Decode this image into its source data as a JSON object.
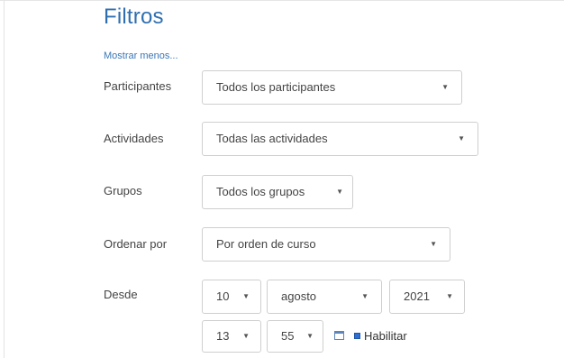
{
  "filters": {
    "title": "Filtros",
    "show_less": "Mostrar menos...",
    "participants": {
      "label": "Participantes",
      "value": "Todos los participantes"
    },
    "activities": {
      "label": "Actividades",
      "value": "Todas las actividades"
    },
    "groups": {
      "label": "Grupos",
      "value": "Todos los grupos"
    },
    "order_by": {
      "label": "Ordenar por",
      "value": "Por orden de curso"
    },
    "since": {
      "label": "Desde",
      "day": "10",
      "month": "agosto",
      "year": "2021",
      "hour": "13",
      "minute": "55",
      "enable_label": "Habilitar",
      "enabled": true
    },
    "caret": "▼"
  },
  "colors": {
    "title": "#2f6fb0",
    "link": "#3a77b7",
    "border": "#cfcfcf",
    "checkbox": "#2f6fd0"
  },
  "icons": {
    "dropdown": "caret-down-icon",
    "calendar": "calendar-icon"
  }
}
